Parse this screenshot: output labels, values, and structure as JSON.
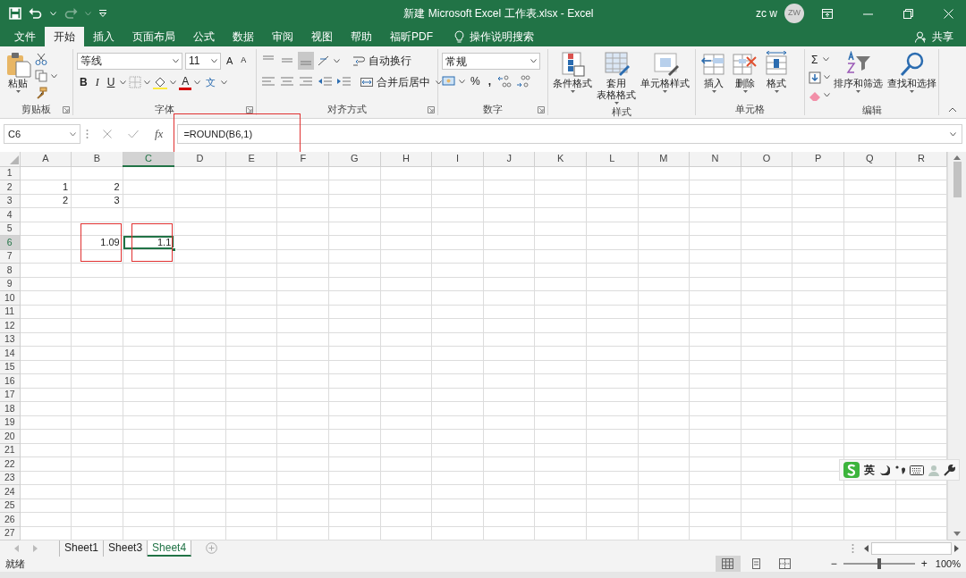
{
  "title_bar": {
    "title": "新建 Microsoft Excel 工作表.xlsx  -  Excel",
    "user": "zc w",
    "avatar": "ZW",
    "redo": {
      "disabled": true
    }
  },
  "tabs": [
    {
      "label": "文件",
      "selected": false
    },
    {
      "label": "开始",
      "selected": true
    },
    {
      "label": "插入",
      "selected": false
    },
    {
      "label": "页面布局",
      "selected": false
    },
    {
      "label": "公式",
      "selected": false
    },
    {
      "label": "数据",
      "selected": false
    },
    {
      "label": "审阅",
      "selected": false
    },
    {
      "label": "视图",
      "selected": false
    },
    {
      "label": "帮助",
      "selected": false
    },
    {
      "label": "福昕PDF",
      "selected": false
    }
  ],
  "tell_me": "操作说明搜索",
  "share": "共享",
  "ribbon": {
    "clipboard": {
      "label": "剪贴板",
      "paste": "粘贴"
    },
    "font": {
      "label": "字体",
      "font_name": "等线",
      "font_size": "11",
      "grow_font": "A",
      "shrink_font": "A",
      "bold": "B",
      "italic": "I",
      "underline": "U",
      "font_color": "A",
      "phonetic": "文"
    },
    "alignment": {
      "label": "对齐方式",
      "wrap_text": "自动换行",
      "merge_center": "合并后居中",
      "vertical_align": [
        {
          "selected": false
        },
        {
          "selected": false
        },
        {
          "selected": true
        }
      ]
    },
    "number": {
      "label": "数字",
      "format": "常规",
      "percent": "%",
      "comma": ","
    },
    "styles": {
      "label": "样式",
      "buttons": [
        {
          "lines": [
            "条件格式"
          ]
        },
        {
          "lines": [
            "套用",
            "表格格式"
          ]
        },
        {
          "lines": [
            "单元格样式"
          ]
        }
      ]
    },
    "cells": {
      "label": "单元格",
      "buttons": [
        "插入",
        "删除",
        "格式"
      ]
    },
    "editing": {
      "label": "编辑",
      "autosum": "Σ",
      "buttons": [
        "排序和筛选",
        "查找和选择"
      ]
    }
  },
  "formula_bar": {
    "name_box": "C6",
    "fx": "fx",
    "formula": "=ROUND(B6,1)",
    "outlined": true
  },
  "columns": [
    {
      "label": "A",
      "selected": false
    },
    {
      "label": "B",
      "selected": false
    },
    {
      "label": "C",
      "selected": true
    },
    {
      "label": "D",
      "selected": false
    },
    {
      "label": "E",
      "selected": false
    },
    {
      "label": "F",
      "selected": false
    },
    {
      "label": "G",
      "selected": false
    },
    {
      "label": "H",
      "selected": false
    },
    {
      "label": "I",
      "selected": false
    },
    {
      "label": "J",
      "selected": false
    },
    {
      "label": "K",
      "selected": false
    },
    {
      "label": "L",
      "selected": false
    },
    {
      "label": "M",
      "selected": false
    },
    {
      "label": "N",
      "selected": false
    },
    {
      "label": "O",
      "selected": false
    },
    {
      "label": "P",
      "selected": false
    },
    {
      "label": "Q",
      "selected": false
    },
    {
      "label": "R",
      "selected": false
    }
  ],
  "rows": [
    {
      "label": "1",
      "selected": false,
      "cells": {}
    },
    {
      "label": "2",
      "selected": false,
      "cells": {
        "A": {
          "value": "1",
          "selected": false,
          "outlined": false
        },
        "B": {
          "value": "2",
          "selected": false,
          "outlined": false
        }
      }
    },
    {
      "label": "3",
      "selected": false,
      "cells": {
        "A": {
          "value": "2",
          "selected": false,
          "outlined": false
        },
        "B": {
          "value": "3",
          "selected": false,
          "outlined": false
        }
      }
    },
    {
      "label": "4",
      "selected": false,
      "cells": {}
    },
    {
      "label": "5",
      "selected": false,
      "cells": {}
    },
    {
      "label": "6",
      "selected": true,
      "cells": {
        "B": {
          "value": "1.09",
          "selected": false,
          "outlined": true
        },
        "C": {
          "value": "1.1",
          "selected": true,
          "outlined": true
        }
      }
    },
    {
      "label": "7",
      "selected": false,
      "cells": {}
    },
    {
      "label": "8",
      "selected": false,
      "cells": {}
    },
    {
      "label": "9",
      "selected": false,
      "cells": {}
    },
    {
      "label": "10",
      "selected": false,
      "cells": {}
    },
    {
      "label": "11",
      "selected": false,
      "cells": {}
    },
    {
      "label": "12",
      "selected": false,
      "cells": {}
    },
    {
      "label": "13",
      "selected": false,
      "cells": {}
    },
    {
      "label": "14",
      "selected": false,
      "cells": {}
    },
    {
      "label": "15",
      "selected": false,
      "cells": {}
    },
    {
      "label": "16",
      "selected": false,
      "cells": {}
    },
    {
      "label": "17",
      "selected": false,
      "cells": {}
    },
    {
      "label": "18",
      "selected": false,
      "cells": {}
    },
    {
      "label": "19",
      "selected": false,
      "cells": {}
    },
    {
      "label": "20",
      "selected": false,
      "cells": {}
    },
    {
      "label": "21",
      "selected": false,
      "cells": {}
    },
    {
      "label": "22",
      "selected": false,
      "cells": {}
    },
    {
      "label": "23",
      "selected": false,
      "cells": {}
    },
    {
      "label": "24",
      "selected": false,
      "cells": {}
    },
    {
      "label": "25",
      "selected": false,
      "cells": {}
    },
    {
      "label": "26",
      "selected": false,
      "cells": {}
    },
    {
      "label": "27",
      "selected": false,
      "cells": {}
    }
  ],
  "sheets": [
    {
      "label": "Sheet1",
      "selected": false
    },
    {
      "label": "Sheet3",
      "selected": false
    },
    {
      "label": "Sheet4",
      "selected": true
    }
  ],
  "status_bar": {
    "status": "就绪",
    "views": [
      {
        "selected": true
      },
      {
        "selected": false
      },
      {
        "selected": false
      }
    ],
    "zoom_minus": "−",
    "zoom_plus": "+",
    "level": 0.5,
    "zoom": "100%"
  },
  "ime_toolbar": {
    "label": "英"
  }
}
